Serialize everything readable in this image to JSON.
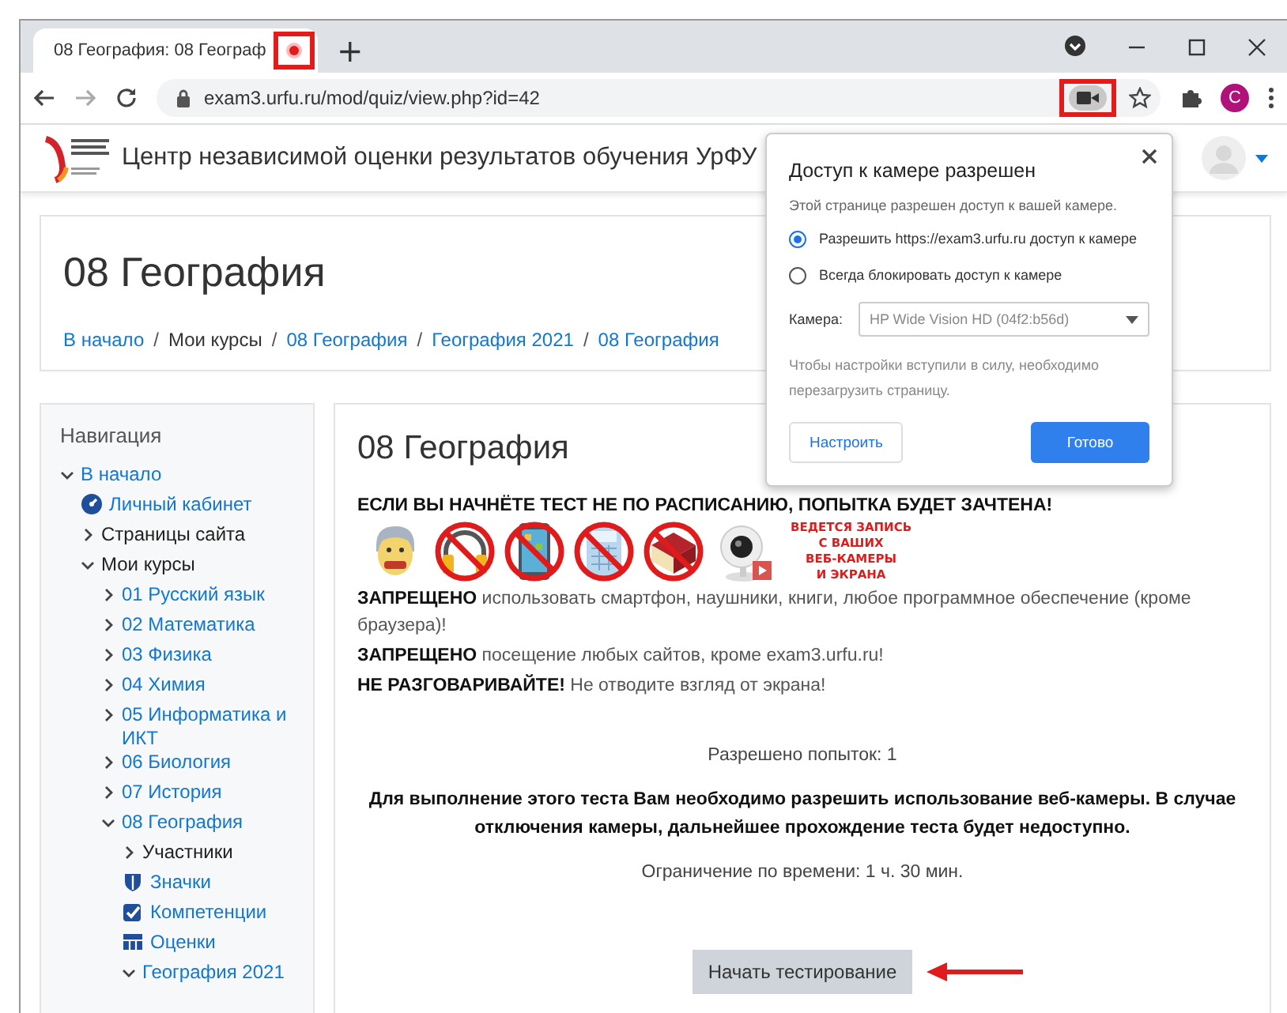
{
  "browser": {
    "tab": {
      "title": "08 География: 08 Географ",
      "recording": true
    },
    "new_tab": "+",
    "url": "exam3.urfu.ru/mod/quiz/view.php?id=42",
    "camera_in_use": true,
    "profile_initial": "C"
  },
  "site_header": {
    "title": "Центр независимой оценки результатов обучения УрФУ"
  },
  "course_header": {
    "title": "08 География",
    "separator": "/",
    "breadcrumbs": [
      {
        "label": "В начало",
        "link": true
      },
      {
        "label": "Мои курсы",
        "link": false
      },
      {
        "label": "08 География",
        "link": true
      },
      {
        "label": "География 2021",
        "link": true
      },
      {
        "label": "08 География",
        "link": true
      }
    ]
  },
  "navigation": {
    "title": "Навигация",
    "items": [
      {
        "label": "В начало",
        "link": true,
        "kind": "branch",
        "expanded": true,
        "children": [
          {
            "label": "Личный кабинет",
            "link": true,
            "kind": "dashboard"
          },
          {
            "label": "Страницы сайта",
            "link": false,
            "kind": "branch",
            "expanded": false
          },
          {
            "label": "Мои курсы",
            "link": false,
            "kind": "branch",
            "expanded": true,
            "children": [
              {
                "label": "01 Русский язык",
                "link": true,
                "kind": "branch",
                "expanded": false
              },
              {
                "label": "02 Математика",
                "link": true,
                "kind": "branch",
                "expanded": false
              },
              {
                "label": "03 Физика",
                "link": true,
                "kind": "branch",
                "expanded": false
              },
              {
                "label": "04 Химия",
                "link": true,
                "kind": "branch",
                "expanded": false
              },
              {
                "label": "05 Информатика и ИКТ",
                "link": true,
                "kind": "branch",
                "expanded": false
              },
              {
                "label": "06 Биология",
                "link": true,
                "kind": "branch",
                "expanded": false
              },
              {
                "label": "07 История",
                "link": true,
                "kind": "branch",
                "expanded": false
              },
              {
                "label": "08 География",
                "link": true,
                "kind": "branch",
                "expanded": true,
                "children": [
                  {
                    "label": "Участники",
                    "link": false,
                    "kind": "branch",
                    "expanded": false
                  },
                  {
                    "label": "Значки",
                    "link": true,
                    "kind": "badges"
                  },
                  {
                    "label": "Компетенции",
                    "link": true,
                    "kind": "competencies"
                  },
                  {
                    "label": "Оценки",
                    "link": true,
                    "kind": "grades"
                  },
                  {
                    "label": "География 2021",
                    "link": true,
                    "kind": "branch",
                    "expanded": true
                  }
                ]
              }
            ]
          }
        ]
      }
    ]
  },
  "main": {
    "title": "08 География",
    "warning": "ЕСЛИ ВЫ НАЧНЁТЕ ТЕСТ НЕ ПО РАСПИСАНИЮ, ПОПЫТКА БУДЕТ ЗАЧТЕНА!",
    "pictograms": [
      {
        "kind": "face",
        "prohibited": false
      },
      {
        "kind": "headphones",
        "prohibited": true
      },
      {
        "kind": "phone",
        "prohibited": true
      },
      {
        "kind": "calculator",
        "prohibited": true
      },
      {
        "kind": "book",
        "prohibited": true
      },
      {
        "kind": "webcam",
        "prohibited": false
      }
    ],
    "recording_notice": [
      "ВЕДЕТСЯ ЗАПИСЬ",
      "С ВАШИХ",
      "ВЕБ-КАМЕРЫ",
      "И ЭКРАНА"
    ],
    "rules": [
      "**ЗАПРЕЩЕНО** использовать смартфон, наушники, книги, любое программное обеспечение (кроме браузера)!",
      "**ЗАПРЕЩЕНО** посещение любых сайтов, кроме exam3.urfu.ru!",
      "**НЕ РАЗГОВАРИВАЙТЕ!** Не отводите взгляд от экрана!"
    ],
    "attempts": "Разрешено попыток: 1",
    "camera_notice": "Для выполнение этого теста Вам необходимо разрешить использование веб-камеры. В случае отключения камеры, дальнейшее прохождение теста будет недоступно.",
    "time_limit": "Ограничение по времени: 1 ч. 30 мин.",
    "start_button": "Начать тестирование"
  },
  "permission_popup": {
    "title": "Доступ к камере разрешен",
    "description": "Этой странице разрешен доступ к вашей камере.",
    "options": [
      {
        "label": "Разрешить https://exam3.urfu.ru доступ к камере",
        "selected": true
      },
      {
        "label": "Всегда блокировать доступ к камере",
        "selected": false
      }
    ],
    "camera_label": "Камера:",
    "camera_value": "HP Wide Vision HD (04f2:b56d)",
    "note": "Чтобы настройки вступили в силу, необходимо перезагрузить страницу.",
    "buttons": [
      {
        "label": "Настроить",
        "kind": "secondary"
      },
      {
        "label": "Готово",
        "kind": "primary"
      }
    ]
  }
}
